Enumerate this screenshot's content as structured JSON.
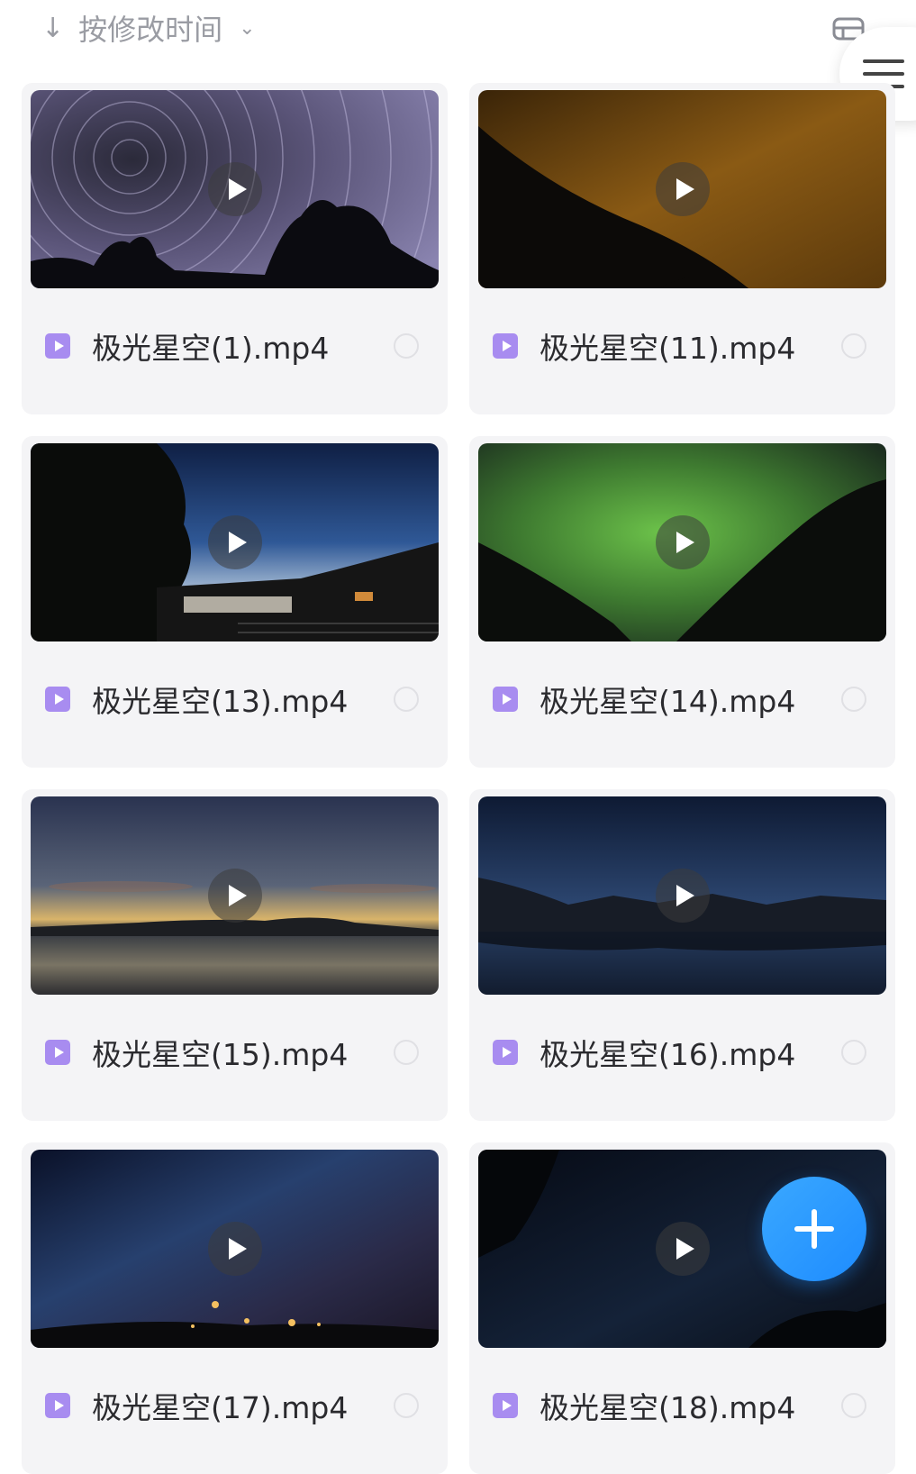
{
  "toolbar": {
    "sort_arrow_icon": "arrow-down-icon",
    "sort_label": "按修改时间",
    "sort_dropdown_icon": "chevron-down-icon",
    "view_toggle_icon": "view-toggle-icon",
    "menu_icon": "hamburger-menu-icon"
  },
  "files": [
    {
      "name": "极光星空(1).mp4",
      "scene": "star-trails"
    },
    {
      "name": "极光星空(11).mp4",
      "scene": "amber-mountain"
    },
    {
      "name": "极光星空(13).mp4",
      "scene": "twilight-house"
    },
    {
      "name": "极光星空(14).mp4",
      "scene": "green-aurora"
    },
    {
      "name": "极光星空(15).mp4",
      "scene": "lake-dawn"
    },
    {
      "name": "极光星空(16).mp4",
      "scene": "mountain-lake-night"
    },
    {
      "name": "极光星空(17).mp4",
      "scene": "milky-way-town"
    },
    {
      "name": "极光星空(18).mp4",
      "scene": "dark-starry-sky"
    }
  ],
  "fab": {
    "icon": "plus-icon"
  },
  "colors": {
    "card_bg": "#f4f4f6",
    "video_icon": "#a88cf0",
    "fab_blue": "#1e8cff",
    "sort_text": "#9a9ca3"
  }
}
